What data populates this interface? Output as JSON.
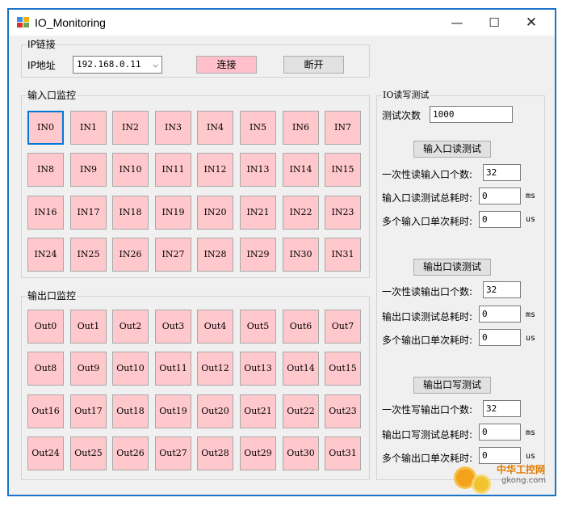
{
  "window": {
    "title": "IO_Monitoring",
    "min_glyph": "—",
    "max_glyph": "☐",
    "close_glyph": "✕"
  },
  "ip_group": {
    "label": "IP链接",
    "ip_label": "IP地址",
    "ip_value": "192.168.0.11",
    "connect_label": "连接",
    "disconnect_label": "断开"
  },
  "input_group": {
    "label": "输入口监控",
    "items": [
      "IN0",
      "IN1",
      "IN2",
      "IN3",
      "IN4",
      "IN5",
      "IN6",
      "IN7",
      "IN8",
      "IN9",
      "IN10",
      "IN11",
      "IN12",
      "IN13",
      "IN14",
      "IN15",
      "IN16",
      "IN17",
      "IN18",
      "IN19",
      "IN20",
      "IN21",
      "IN22",
      "IN23",
      "IN24",
      "IN25",
      "IN26",
      "IN27",
      "IN28",
      "IN29",
      "IN30",
      "IN31"
    ]
  },
  "output_group": {
    "label": "输出口监控",
    "items": [
      "Out0",
      "Out1",
      "Out2",
      "Out3",
      "Out4",
      "Out5",
      "Out6",
      "Out7",
      "Out8",
      "Out9",
      "Out10",
      "Out11",
      "Out12",
      "Out13",
      "Out14",
      "Out15",
      "Out16",
      "Out17",
      "Out18",
      "Out19",
      "Out20",
      "Out21",
      "Out22",
      "Out23",
      "Out24",
      "Out25",
      "Out26",
      "Out27",
      "Out28",
      "Out29",
      "Out30",
      "Out31"
    ]
  },
  "rw_group": {
    "label": "IO读写测试",
    "test_count_label": "测试次数",
    "test_count_value": "1000",
    "input_read": {
      "button": "输入口读测试",
      "count_label": "一次性读输入口个数:",
      "count_value": "32",
      "total_label": "输入口读测试总耗时:",
      "total_value": "0",
      "total_unit": "ms",
      "single_label": "多个输入口单次耗时:",
      "single_value": "0",
      "single_unit": "us"
    },
    "output_read": {
      "button": "输出口读测试",
      "count_label": "一次性读输出口个数:",
      "count_value": "32",
      "total_label": "输出口读测试总耗时:",
      "total_value": "0",
      "total_unit": "ms",
      "single_label": "多个输出口单次耗时:",
      "single_value": "0",
      "single_unit": "us"
    },
    "output_write": {
      "button": "输出口写测试",
      "count_label": "一次性写输出口个数:",
      "count_value": "32",
      "total_label": "输出口写测试总耗时:",
      "total_value": "0",
      "total_unit": "ms",
      "single_label": "多个输出口单次耗时:",
      "single_value": "0",
      "single_unit": "us"
    }
  },
  "watermark": {
    "line1": "中华工控网",
    "line2": "gkong.com"
  },
  "colors": {
    "io_pink": "#ffc8cc",
    "button_pink": "#ffc0cb",
    "focus_blue": "#0078d7",
    "window_border": "#1a73c9"
  }
}
